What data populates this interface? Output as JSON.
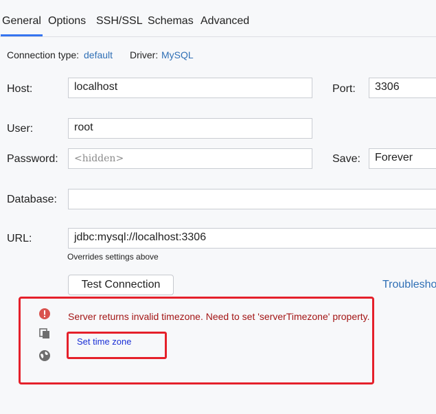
{
  "tabs": [
    {
      "label": "General"
    },
    {
      "label": "Options"
    },
    {
      "label": "SSH/SSL"
    },
    {
      "label": "Schemas"
    },
    {
      "label": "Advanced"
    }
  ],
  "info": {
    "connection_type_label": "Connection type:",
    "connection_type_value": "default",
    "driver_label": "Driver:",
    "driver_value": "MySQL"
  },
  "form": {
    "host_label": "Host:",
    "host_value": "localhost",
    "port_label": "Port:",
    "port_value": "3306",
    "user_label": "User:",
    "user_value": "root",
    "password_label": "Password:",
    "password_placeholder": "<hidden>",
    "save_label": "Save:",
    "save_value": "Forever",
    "database_label": "Database:",
    "database_value": "",
    "url_label": "URL:",
    "url_value": "jdbc:mysql://localhost:3306",
    "url_hint": "Overrides settings above"
  },
  "actions": {
    "test_connection": "Test Connection",
    "troubleshoot": "Troubleshoo"
  },
  "error": {
    "message": "Server returns invalid timezone. Need to set 'serverTimezone' property.",
    "fix_link": "Set time zone"
  },
  "colors": {
    "accent": "#3574f0",
    "error_text": "#a31515",
    "highlight_border": "#e5202a",
    "link": "#2f6fb5"
  }
}
